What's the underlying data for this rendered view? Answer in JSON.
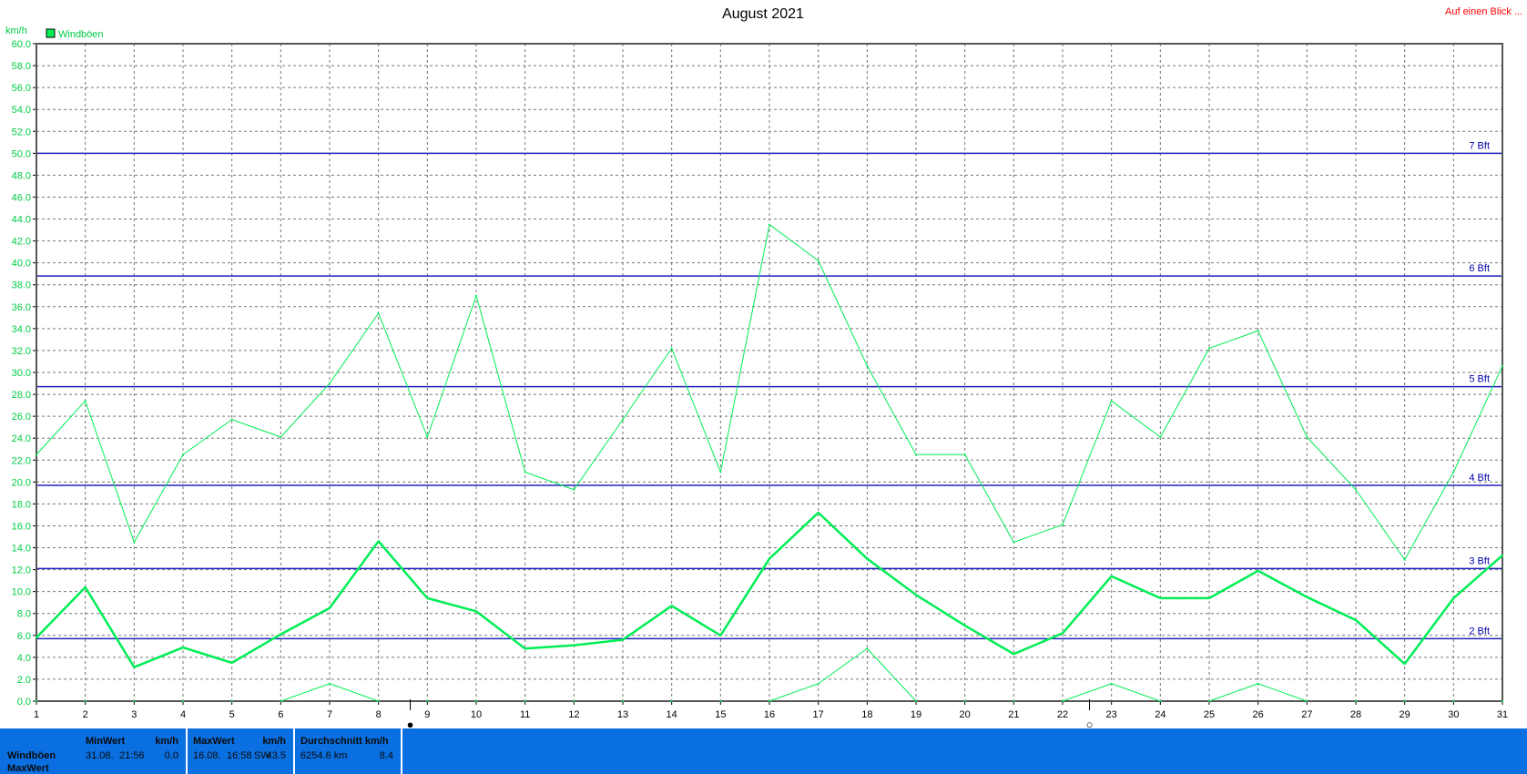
{
  "chart_data": {
    "type": "line",
    "title": "August 2021",
    "link_text": "Auf einen Blick ...",
    "ylabel": "km/h",
    "ylim": [
      0,
      60
    ],
    "yticks": [
      "0.0",
      "2.0",
      "4.0",
      "6.0",
      "8.0",
      "10.0",
      "12.0",
      "14.0",
      "16.0",
      "18.0",
      "20.0",
      "22.0",
      "24.0",
      "26.0",
      "28.0",
      "30.0",
      "32.0",
      "34.0",
      "36.0",
      "38.0",
      "40.0",
      "42.0",
      "44.0",
      "46.0",
      "48.0",
      "50.0",
      "52.0",
      "54.0",
      "56.0",
      "58.0",
      "60.0"
    ],
    "x": [
      1,
      2,
      3,
      4,
      5,
      6,
      7,
      8,
      9,
      10,
      11,
      12,
      13,
      14,
      15,
      16,
      17,
      18,
      19,
      20,
      21,
      22,
      23,
      24,
      25,
      26,
      27,
      28,
      29,
      30,
      31
    ],
    "legend": [
      "Windböen"
    ],
    "grid": true,
    "series": [
      {
        "name": "Windböen",
        "role": "max",
        "color": "#00ee55",
        "values": [
          22.5,
          27.4,
          14.5,
          22.5,
          25.7,
          24.1,
          29.0,
          35.4,
          24.1,
          37.0,
          20.9,
          19.3,
          25.7,
          32.2,
          20.9,
          43.5,
          40.2,
          30.6,
          22.5,
          22.5,
          14.5,
          16.1,
          27.4,
          24.1,
          32.2,
          33.8,
          24.1,
          19.3,
          12.9,
          20.9,
          30.6
        ]
      },
      {
        "role": "average",
        "color": "#00ee55",
        "values": [
          5.8,
          10.4,
          3.1,
          4.9,
          3.5,
          6.1,
          8.5,
          14.6,
          9.4,
          8.2,
          4.8,
          5.1,
          5.6,
          8.7,
          6.0,
          13.0,
          17.2,
          13.0,
          9.7,
          6.9,
          4.3,
          6.2,
          11.4,
          9.4,
          9.4,
          11.9,
          9.5,
          7.4,
          3.4,
          9.4,
          13.3
        ]
      },
      {
        "role": "min",
        "color": "#00ee55",
        "values": [
          0,
          0,
          0,
          0,
          0,
          0,
          1.6,
          0,
          0,
          0,
          0,
          0,
          0,
          0,
          0,
          0,
          1.6,
          4.8,
          0,
          0,
          0,
          0,
          1.6,
          0,
          0,
          1.6,
          0,
          0,
          0,
          0,
          0
        ]
      }
    ],
    "reference_lines": [
      {
        "label": "2 Bft",
        "value": 5.7
      },
      {
        "label": "3 Bft",
        "value": 12.1
      },
      {
        "label": "4 Bft",
        "value": 19.7
      },
      {
        "label": "5 Bft",
        "value": 28.7
      },
      {
        "label": "6 Bft",
        "value": 38.8
      },
      {
        "label": "7 Bft",
        "value": 50.0
      }
    ],
    "markers": [
      {
        "x": 8.65,
        "symbol": "●"
      },
      {
        "x": 22.55,
        "symbol": "○"
      }
    ]
  },
  "footer": {
    "row_labels": [
      "Windböen",
      "MaxWert"
    ],
    "min": {
      "header": "MinWert",
      "unit": "km/h",
      "date": "31.08.",
      "time": "21:56",
      "value": "0.0"
    },
    "max": {
      "header": "MaxWert",
      "unit": "km/h",
      "date": "16.08.",
      "time": "16:58",
      "dir": "SW",
      "value": "43.5"
    },
    "avg": {
      "header": "Durchschnitt km/h",
      "total": "6254.6 km",
      "value": "8.4"
    }
  },
  "colors": {
    "series": "#00ee55",
    "reference": "#2020c0",
    "footer": "#0a6fe0"
  }
}
